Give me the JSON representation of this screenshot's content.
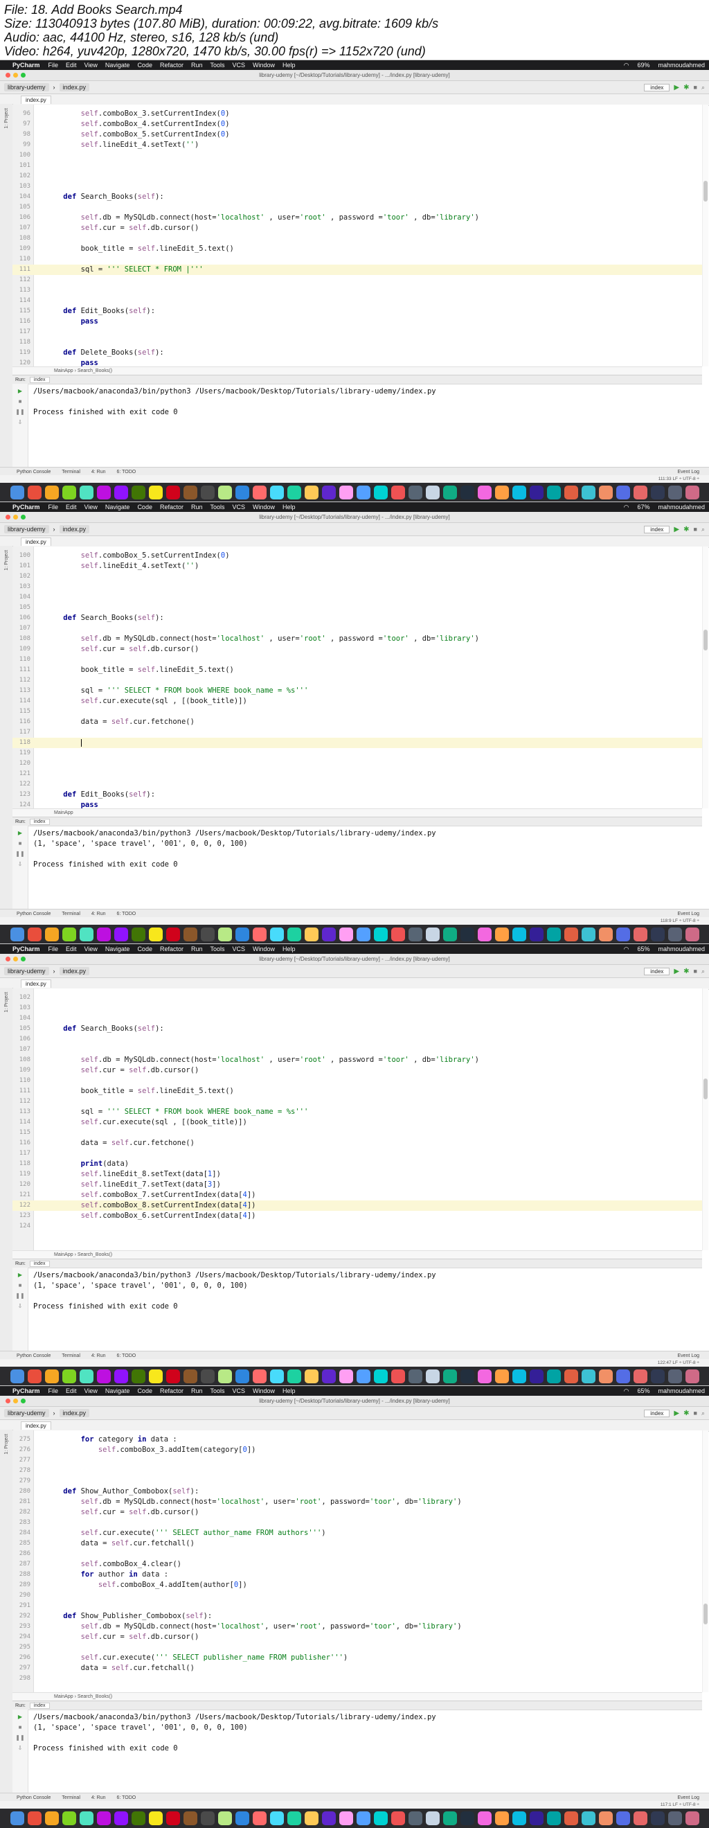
{
  "info": [
    "File: 18. Add Books Search.mp4",
    "Size: 113040913 bytes (107.80 MiB), duration: 00:09:22, avg.bitrate: 1609 kb/s",
    "Audio: aac, 44100 Hz, stereo, s16, 128 kb/s (und)",
    "Video: h264, yuv420p, 1280x720, 1470 kb/s, 30.00 fps(r) => 1152x720 (und)"
  ],
  "menubar": {
    "app": "PyCharm",
    "items": [
      "File",
      "Edit",
      "View",
      "Navigate",
      "Code",
      "Refactor",
      "Run",
      "Tools",
      "VCS",
      "Window",
      "Help"
    ],
    "user": "mahmoudahmed"
  },
  "window_title": "library-udemy [~/Desktop/Tutorials/library-udemy] - .../index.py [library-udemy]",
  "project": "library-udemy",
  "file": "index.py",
  "run_config": "index",
  "run_label": "Run:",
  "run_tab": "index",
  "bottom_tools": [
    "Python Console",
    "Terminal",
    "4: Run",
    "6: TODO"
  ],
  "event_log": "Event Log",
  "side_tools": [
    "1: Project",
    "2: Favorites",
    "Z: Structure"
  ],
  "frames": [
    {
      "crumb": "MainApp  ›  Search_Books()",
      "status": "111:33   LF ÷   UTF-8 ÷",
      "battery": "69%",
      "code": [
        {
          "n": "96",
          "t": "        self.comboBox_3.setCurrentIndex(0)"
        },
        {
          "n": "97",
          "t": "        self.comboBox_4.setCurrentIndex(0)"
        },
        {
          "n": "98",
          "t": "        self.comboBox_5.setCurrentIndex(0)"
        },
        {
          "n": "99",
          "t": "        self.lineEdit_4.setText('')"
        },
        {
          "n": "100",
          "t": ""
        },
        {
          "n": "101",
          "t": ""
        },
        {
          "n": "102",
          "t": ""
        },
        {
          "n": "103",
          "t": ""
        },
        {
          "n": "104",
          "t": "    def Search_Books(self):"
        },
        {
          "n": "105",
          "t": ""
        },
        {
          "n": "106",
          "t": "        self.db = MySQLdb.connect(host='localhost' , user='root' , password ='toor' , db='library')"
        },
        {
          "n": "107",
          "t": "        self.cur = self.db.cursor()"
        },
        {
          "n": "108",
          "t": ""
        },
        {
          "n": "109",
          "t": "        book_title = self.lineEdit_5.text()"
        },
        {
          "n": "110",
          "t": ""
        },
        {
          "n": "111",
          "t": "        sql = ''' SELECT * FROM |'''",
          "hl": true
        },
        {
          "n": "112",
          "t": ""
        },
        {
          "n": "113",
          "t": ""
        },
        {
          "n": "114",
          "t": ""
        },
        {
          "n": "115",
          "t": "    def Edit_Books(self):"
        },
        {
          "n": "116",
          "t": "        pass"
        },
        {
          "n": "117",
          "t": ""
        },
        {
          "n": "118",
          "t": ""
        },
        {
          "n": "119",
          "t": "    def Delete_Books(self):"
        },
        {
          "n": "120",
          "t": "        pass"
        }
      ],
      "output": [
        "/Users/macbook/anaconda3/bin/python3 /Users/macbook/Desktop/Tutorials/library-udemy/index.py",
        "",
        "Process finished with exit code 0"
      ]
    },
    {
      "crumb": "MainApp",
      "status": "118:9   LF ÷   UTF-8 ÷",
      "battery": "67%",
      "code": [
        {
          "n": "100",
          "t": "        self.comboBox_5.setCurrentIndex(0)"
        },
        {
          "n": "101",
          "t": "        self.lineEdit_4.setText('')"
        },
        {
          "n": "102",
          "t": ""
        },
        {
          "n": "103",
          "t": ""
        },
        {
          "n": "104",
          "t": ""
        },
        {
          "n": "105",
          "t": ""
        },
        {
          "n": "106",
          "t": "    def Search_Books(self):"
        },
        {
          "n": "107",
          "t": ""
        },
        {
          "n": "108",
          "t": "        self.db = MySQLdb.connect(host='localhost' , user='root' , password ='toor' , db='library')"
        },
        {
          "n": "109",
          "t": "        self.cur = self.db.cursor()"
        },
        {
          "n": "110",
          "t": ""
        },
        {
          "n": "111",
          "t": "        book_title = self.lineEdit_5.text()"
        },
        {
          "n": "112",
          "t": ""
        },
        {
          "n": "113",
          "t": "        sql = ''' SELECT * FROM book WHERE book_name = %s'''"
        },
        {
          "n": "114",
          "t": "        self.cur.execute(sql , [(book_title)])"
        },
        {
          "n": "115",
          "t": ""
        },
        {
          "n": "116",
          "t": "        data = self.cur.fetchone()"
        },
        {
          "n": "117",
          "t": ""
        },
        {
          "n": "118",
          "t": "        |",
          "hl": true
        },
        {
          "n": "119",
          "t": ""
        },
        {
          "n": "120",
          "t": ""
        },
        {
          "n": "121",
          "t": ""
        },
        {
          "n": "122",
          "t": ""
        },
        {
          "n": "123",
          "t": "    def Edit_Books(self):"
        },
        {
          "n": "124",
          "t": "        pass"
        }
      ],
      "output": [
        "/Users/macbook/anaconda3/bin/python3 /Users/macbook/Desktop/Tutorials/library-udemy/index.py",
        "(1, 'space', 'space travel', '001', 0, 0, 0, 100)",
        "",
        "Process finished with exit code 0"
      ]
    },
    {
      "crumb": "MainApp  ›  Search_Books()",
      "status": "122:47   LF ÷   UTF-8 ÷",
      "battery": "65%",
      "code": [
        {
          "n": "102",
          "t": ""
        },
        {
          "n": "103",
          "t": ""
        },
        {
          "n": "104",
          "t": ""
        },
        {
          "n": "105",
          "t": "    def Search_Books(self):"
        },
        {
          "n": "106",
          "t": ""
        },
        {
          "n": "107",
          "t": ""
        },
        {
          "n": "108",
          "t": "        self.db = MySQLdb.connect(host='localhost' , user='root' , password ='toor' , db='library')"
        },
        {
          "n": "109",
          "t": "        self.cur = self.db.cursor()"
        },
        {
          "n": "110",
          "t": ""
        },
        {
          "n": "111",
          "t": "        book_title = self.lineEdit_5.text()"
        },
        {
          "n": "112",
          "t": ""
        },
        {
          "n": "113",
          "t": "        sql = ''' SELECT * FROM book WHERE book_name = %s'''"
        },
        {
          "n": "114",
          "t": "        self.cur.execute(sql , [(book_title)])"
        },
        {
          "n": "115",
          "t": ""
        },
        {
          "n": "116",
          "t": "        data = self.cur.fetchone()"
        },
        {
          "n": "117",
          "t": ""
        },
        {
          "n": "118",
          "t": "        print(data)"
        },
        {
          "n": "119",
          "t": "        self.lineEdit_8.setText(data[1])"
        },
        {
          "n": "120",
          "t": "        self.lineEdit_7.setText(data[3])"
        },
        {
          "n": "121",
          "t": "        self.comboBox_7.setCurrentIndex(data[4])"
        },
        {
          "n": "122",
          "t": "        self.comboBox_8.setCurrentIndex(data[4])",
          "hl": true
        },
        {
          "n": "123",
          "t": "        self.comboBox_6.setCurrentIndex(data[4])"
        },
        {
          "n": "124",
          "t": ""
        }
      ],
      "output": [
        "/Users/macbook/anaconda3/bin/python3 /Users/macbook/Desktop/Tutorials/library-udemy/index.py",
        "(1, 'space', 'space travel', '001', 0, 0, 0, 100)",
        "",
        "Process finished with exit code 0"
      ]
    },
    {
      "crumb": "MainApp  ›  Search_Books()",
      "status": "117:1   LF ÷   UTF-8 ÷",
      "battery": "65%",
      "code": [
        {
          "n": "275",
          "t": "        for category in data :"
        },
        {
          "n": "276",
          "t": "            self.comboBox_3.addItem(category[0])"
        },
        {
          "n": "277",
          "t": ""
        },
        {
          "n": "278",
          "t": ""
        },
        {
          "n": "279",
          "t": ""
        },
        {
          "n": "280",
          "t": "    def Show_Author_Combobox(self):"
        },
        {
          "n": "281",
          "t": "        self.db = MySQLdb.connect(host='localhost', user='root', password='toor', db='library')"
        },
        {
          "n": "282",
          "t": "        self.cur = self.db.cursor()"
        },
        {
          "n": "283",
          "t": ""
        },
        {
          "n": "284",
          "t": "        self.cur.execute(''' SELECT author_name FROM authors''')"
        },
        {
          "n": "285",
          "t": "        data = self.cur.fetchall()"
        },
        {
          "n": "286",
          "t": ""
        },
        {
          "n": "287",
          "t": "        self.comboBox_4.clear()"
        },
        {
          "n": "288",
          "t": "        for author in data :"
        },
        {
          "n": "289",
          "t": "            self.comboBox_4.addItem(author[0])"
        },
        {
          "n": "290",
          "t": ""
        },
        {
          "n": "291",
          "t": ""
        },
        {
          "n": "292",
          "t": "    def Show_Publisher_Combobox(self):"
        },
        {
          "n": "293",
          "t": "        self.db = MySQLdb.connect(host='localhost', user='root', password='toor', db='library')"
        },
        {
          "n": "294",
          "t": "        self.cur = self.db.cursor()"
        },
        {
          "n": "295",
          "t": ""
        },
        {
          "n": "296",
          "t": "        self.cur.execute(''' SELECT publisher_name FROM publisher''')"
        },
        {
          "n": "297",
          "t": "        data = self.cur.fetchall()"
        },
        {
          "n": "298",
          "t": ""
        }
      ],
      "output": [
        "/Users/macbook/anaconda3/bin/python3 /Users/macbook/Desktop/Tutorials/library-udemy/index.py",
        "(1, 'space', 'space travel', '001', 0, 0, 0, 100)",
        "",
        "Process finished with exit code 0"
      ]
    }
  ],
  "dock_colors": [
    "#4a90e2",
    "#e94e3c",
    "#f5a623",
    "#7ed321",
    "#50e3c2",
    "#bd10e0",
    "#9013fe",
    "#417505",
    "#f8e71c",
    "#d0021b",
    "#8b572a",
    "#4a4a4a",
    "#b8e986",
    "#2e86de",
    "#ff6b6b",
    "#48dbfb",
    "#1dd1a1",
    "#feca57",
    "#5f27cd",
    "#ff9ff3",
    "#54a0ff",
    "#00d2d3",
    "#ee5253",
    "#576574",
    "#c8d6e5",
    "#10ac84",
    "#222f3e",
    "#f368e0",
    "#ff9f43",
    "#0abde3",
    "#341f97",
    "#01a3a4",
    "#e15f41",
    "#3dc1d3",
    "#f19066",
    "#546de5",
    "#e66767",
    "#303952",
    "#596275",
    "#cf6a87"
  ]
}
